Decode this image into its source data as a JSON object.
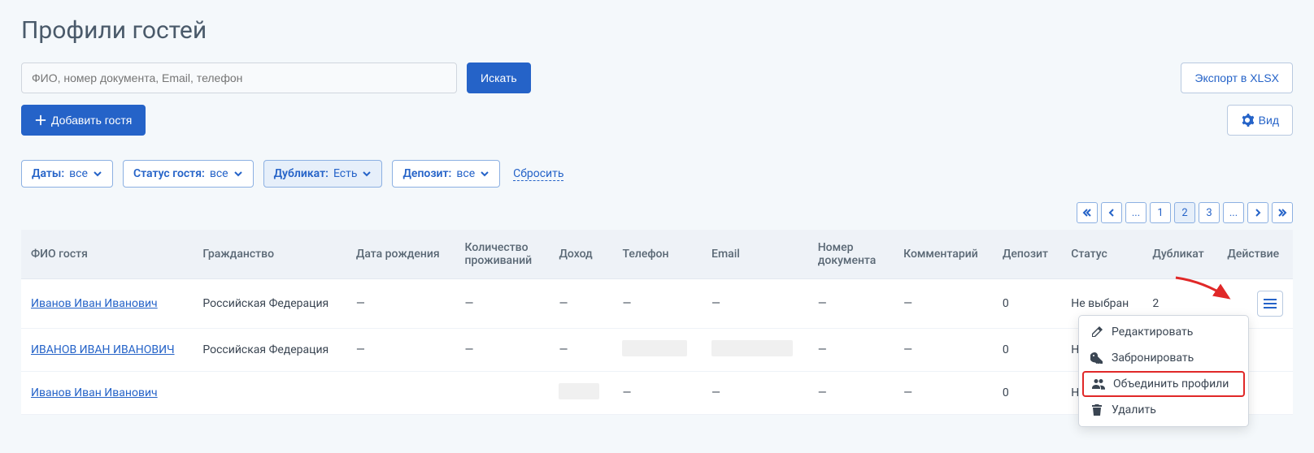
{
  "page_title": "Профили гостей",
  "search": {
    "placeholder": "ФИО, номер документа, Email, телефон",
    "button": "Искать"
  },
  "buttons": {
    "export": "Экспорт в XLSX",
    "add_guest": "Добавить гостя",
    "view": "Вид"
  },
  "filters": {
    "dates": {
      "label": "Даты:",
      "value": "все"
    },
    "status": {
      "label": "Статус гостя:",
      "value": "все"
    },
    "duplicate": {
      "label": "Дубликат:",
      "value": "Есть"
    },
    "deposit": {
      "label": "Депозит:",
      "value": "все"
    },
    "reset": "Сбросить"
  },
  "pager": {
    "pages": [
      "1",
      "2",
      "3"
    ],
    "active": "2",
    "ellipsis": "..."
  },
  "table": {
    "headers": {
      "name": "ФИО гостя",
      "citizenship": "Гражданство",
      "dob": "Дата рождения",
      "stays": "Количество проживаний",
      "income": "Доход",
      "phone": "Телефон",
      "email": "Email",
      "doc": "Номер документа",
      "comment": "Комментарий",
      "deposit": "Депозит",
      "status": "Статус",
      "duplicate": "Дубликат",
      "action": "Действие"
    },
    "rows": [
      {
        "name": "Иванов Иван Иванович",
        "citizenship": "Российская Федерация",
        "dob": "—",
        "stays": "—",
        "income": "—",
        "phone": "—",
        "email": "—",
        "doc": "—",
        "comment": "—",
        "deposit": "0",
        "status": "Не выбран",
        "duplicate": "2"
      },
      {
        "name": "ИВАНОВ ИВАН ИВАНОВИЧ",
        "citizenship": "Российская Федерация",
        "dob": "—",
        "stays": "—",
        "income": "—",
        "phone": "",
        "email": "",
        "doc": "—",
        "comment": "—",
        "deposit": "0",
        "status": "Не выбран",
        "duplicate": ""
      },
      {
        "name": "Иванов Иван Иванович",
        "citizenship": "",
        "dob": "",
        "stays": "",
        "income": "",
        "phone": "—",
        "email": "—",
        "doc": "—",
        "comment": "—",
        "deposit": "0",
        "status": "Не выбран",
        "duplicate": ""
      }
    ]
  },
  "dropdown": {
    "edit": "Редактировать",
    "book": "Забронировать",
    "merge": "Объединить профили",
    "delete": "Удалить"
  }
}
